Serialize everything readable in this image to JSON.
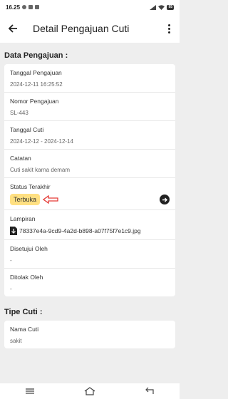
{
  "status_bar": {
    "time": "16.25",
    "battery": "95"
  },
  "app_bar": {
    "title": "Detail Pengajuan Cuti"
  },
  "section_pengajuan": {
    "title": "Data Pengajuan :",
    "tanggal_pengajuan": {
      "label": "Tanggal Pengajuan",
      "value": "2024-12-11 16:25:52"
    },
    "nomor_pengajuan": {
      "label": "Nomor Pengajuan",
      "value": "SL-443"
    },
    "tanggal_cuti": {
      "label": "Tanggal Cuti",
      "value": "2024-12-12 - 2024-12-14"
    },
    "catatan": {
      "label": "Catatan",
      "value": "Cuti sakit karna demam"
    },
    "status": {
      "label": "Status Terakhir",
      "value": "Terbuka",
      "badge_color": "#ffe082"
    },
    "lampiran": {
      "label": "Lampiran",
      "file_name": "78337e4a-9cd9-4a2d-b898-a07f75f7e1c9.jpg"
    },
    "disetujui": {
      "label": "Disetujui Oleh",
      "value": "-"
    },
    "ditolak": {
      "label": "Ditolak Oleh",
      "value": "-"
    }
  },
  "section_tipe": {
    "title": "Tipe Cuti :",
    "nama_cuti": {
      "label": "Nama Cuti",
      "value": "sakit"
    }
  },
  "colors": {
    "annotation_arrow": "#e53935",
    "badge": "#ffe082"
  }
}
